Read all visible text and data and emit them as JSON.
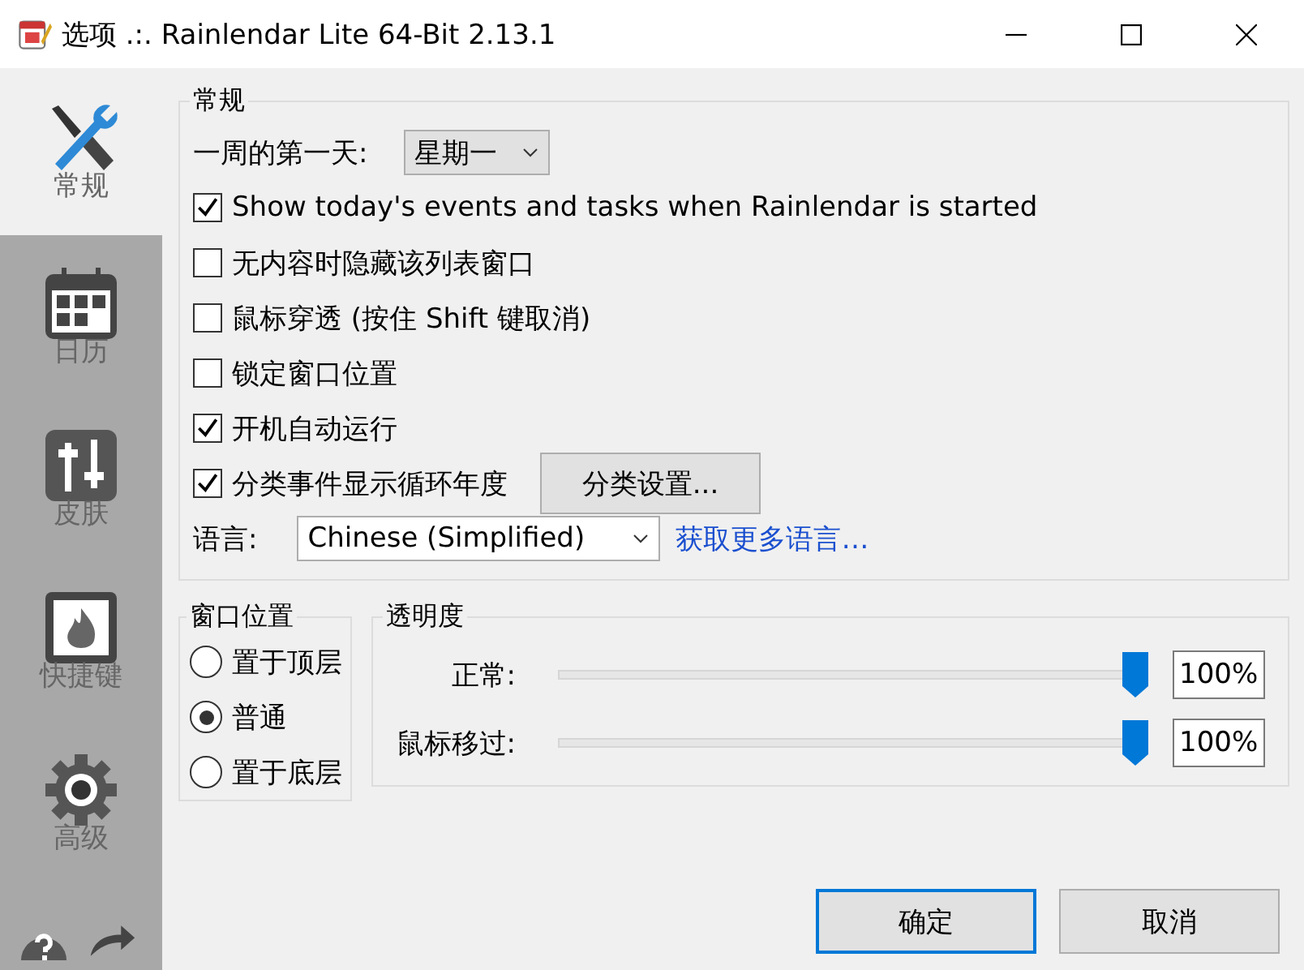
{
  "window": {
    "title": "选项 .:. Rainlendar Lite 64-Bit 2.13.1"
  },
  "sidebar": {
    "items": [
      {
        "label": "常规",
        "kind": "general",
        "selected": true
      },
      {
        "label": "日历",
        "kind": "calendar",
        "selected": false
      },
      {
        "label": "皮肤",
        "kind": "skin",
        "selected": false
      },
      {
        "label": "快捷键",
        "kind": "hotkey",
        "selected": false
      },
      {
        "label": "高级",
        "kind": "advanced",
        "selected": false
      }
    ]
  },
  "general": {
    "title": "常规",
    "first_day": {
      "label": "一周的第一天:",
      "value": "星期一"
    },
    "options": [
      {
        "label": "Show today's events and tasks when Rainlendar is started",
        "checked": true
      },
      {
        "label": "无内容时隐藏该列表窗口",
        "checked": false
      },
      {
        "label": "鼠标穿透 (按住 Shift 键取消)",
        "checked": false
      },
      {
        "label": "锁定窗口位置",
        "checked": false
      },
      {
        "label": "开机自动运行",
        "checked": true
      },
      {
        "label": "分类事件显示循环年度",
        "checked": true
      }
    ],
    "category_button": "分类设置...",
    "language": {
      "label": "语言:",
      "value": "Chinese (Simplified)",
      "link": "获取更多语言…"
    }
  },
  "window_position": {
    "title": "窗口位置",
    "options": [
      {
        "label": "置于顶层",
        "selected": false
      },
      {
        "label": "普通",
        "selected": true
      },
      {
        "label": "置于底层",
        "selected": false
      }
    ]
  },
  "transparency": {
    "title": "透明度",
    "sliders": [
      {
        "label": "正常:",
        "level": 1.0,
        "reading": "100%"
      },
      {
        "label": "鼠标移过:",
        "level": 1.0,
        "reading": "100%"
      }
    ]
  },
  "buttons": [
    {
      "label": "确定",
      "default": true
    },
    {
      "label": "取消",
      "default": false
    }
  ]
}
